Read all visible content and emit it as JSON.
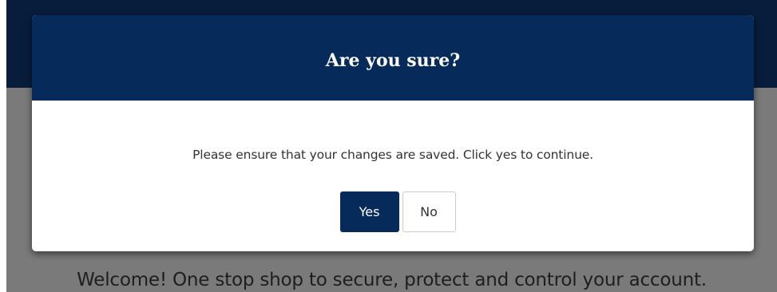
{
  "background": {
    "welcome_text": "Welcome! One stop shop to secure, protect and control your account."
  },
  "dialog": {
    "title": "Are you sure?",
    "message": "Please ensure that your changes are saved. Click yes to continue.",
    "yes_label": "Yes",
    "no_label": "No"
  },
  "colors": {
    "header_navy": "#062a5a",
    "app_header": "#081c3c",
    "overlay_gray": "#7a7a7a"
  }
}
